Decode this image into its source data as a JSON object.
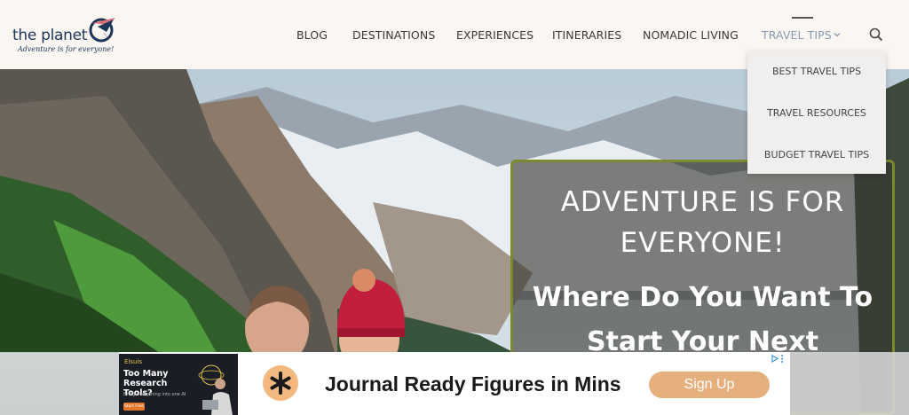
{
  "brand": {
    "name": "the planet",
    "tagline": "Adventure is for everyone!"
  },
  "nav": {
    "items": [
      {
        "label": "BLOG"
      },
      {
        "label": "DESTINATIONS"
      },
      {
        "label": "EXPERIENCES"
      },
      {
        "label": "ITINERARIES"
      },
      {
        "label": "NOMADIC LIVING"
      },
      {
        "label": "TRAVEL TIPS"
      }
    ],
    "active": "TRAVEL TIPS",
    "search_icon": "search-icon"
  },
  "dropdown": {
    "items": [
      {
        "label": "BEST TRAVEL TIPS"
      },
      {
        "label": "TRAVEL RESOURCES"
      },
      {
        "label": "BUDGET TRAVEL TIPS"
      }
    ]
  },
  "hero": {
    "heading": "ADVENTURE IS FOR EVERYONE!",
    "subheading": "Where Do You Want To Start Your Next"
  },
  "ad": {
    "thumb_brand": "Elsuis",
    "thumb_headline": "Too Many Research Tools?",
    "thumb_subtext": "Bring everything into one AI",
    "thumb_cta": "Start Free",
    "headline": "Journal Ready Figures in Mins",
    "cta": "Sign Up"
  },
  "colors": {
    "header_bg": "#faf6f1",
    "callout_border": "#7c8a2e",
    "active_nav": "#8a9bb0",
    "ad_cta": "#e6b07e"
  }
}
